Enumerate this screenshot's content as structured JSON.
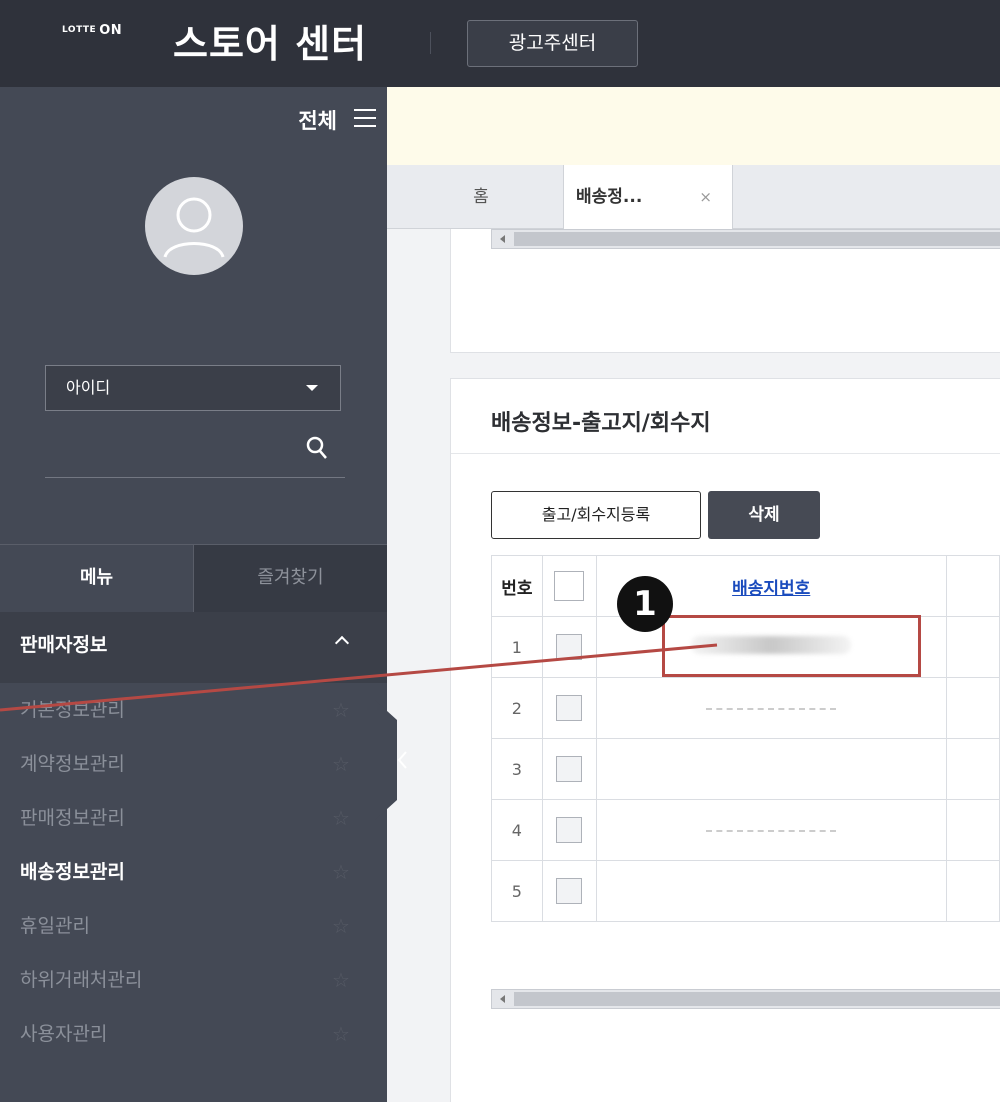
{
  "header": {
    "brand_prefix": "LOTTE",
    "brand_suffix": "ON",
    "title": "스토어 센터",
    "ad_center_label": "광고주센터"
  },
  "sidebar": {
    "all_label": "전체",
    "id_select_value": "아이디",
    "tabs": {
      "menu": "메뉴",
      "favorites": "즐겨찾기"
    },
    "section_title": "판매자정보",
    "items": [
      {
        "label": "기본정보관리",
        "active": false
      },
      {
        "label": "계약정보관리",
        "active": false
      },
      {
        "label": "판매정보관리",
        "active": false
      },
      {
        "label": "배송정보관리",
        "active": true
      },
      {
        "label": "휴일관리",
        "active": false
      },
      {
        "label": "하위거래처관리",
        "active": false
      },
      {
        "label": "사용자관리",
        "active": false
      }
    ]
  },
  "tabs": {
    "home_label": "홈",
    "active_label": "배송정...",
    "close_symbol": "×"
  },
  "panel": {
    "title": "배송정보-출고지/회수지",
    "register_button": "출고/회수지등록",
    "delete_button": "삭제",
    "columns": {
      "number": "번호",
      "shipping_no": "배송지번호"
    },
    "rows": [
      {
        "no": "1"
      },
      {
        "no": "2"
      },
      {
        "no": "3"
      },
      {
        "no": "4"
      },
      {
        "no": "5"
      }
    ]
  },
  "annotation": {
    "marker_label": "1",
    "color": "#b54944"
  }
}
